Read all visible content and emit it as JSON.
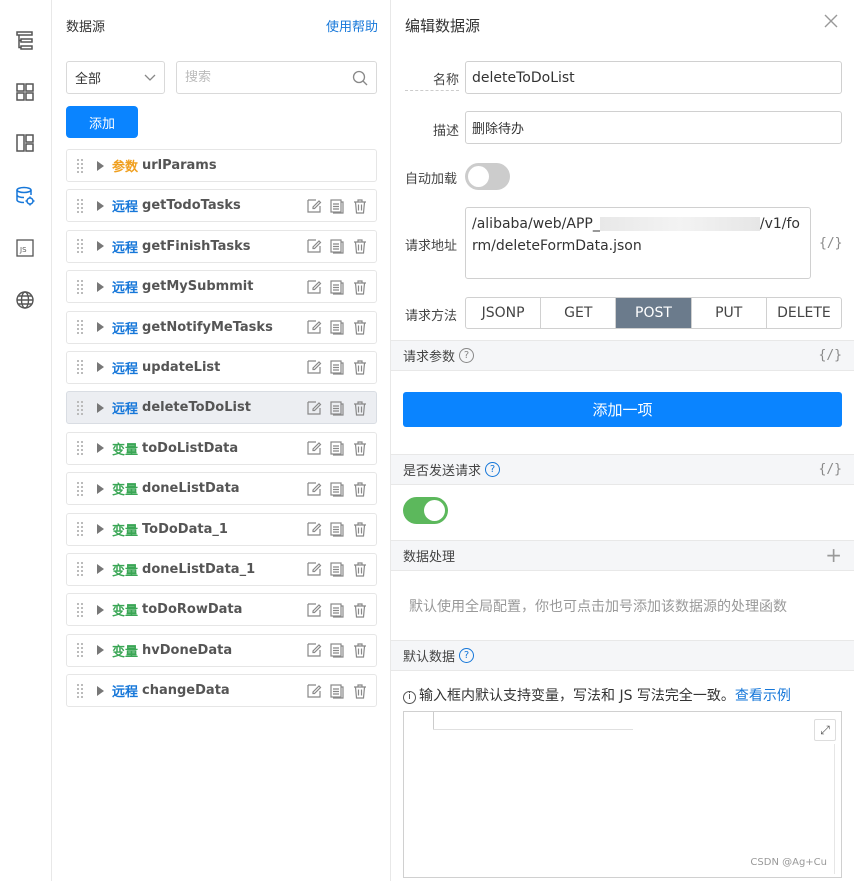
{
  "rail": {
    "icons": [
      "outline-icon",
      "components-icon",
      "layout-icon",
      "datasource-icon",
      "js-icon",
      "globe-icon"
    ]
  },
  "datasource": {
    "title": "数据源",
    "help": "使用帮助",
    "filter_value": "全部",
    "search_placeholder": "搜索",
    "add_label": "添加",
    "items": [
      {
        "tag": "参数",
        "kind": "param",
        "name": "urlParams",
        "actions": false,
        "selected": false
      },
      {
        "tag": "远程",
        "kind": "remote",
        "name": "getTodoTasks",
        "actions": true,
        "selected": false
      },
      {
        "tag": "远程",
        "kind": "remote",
        "name": "getFinishTasks",
        "actions": true,
        "selected": false
      },
      {
        "tag": "远程",
        "kind": "remote",
        "name": "getMySubmmit",
        "actions": true,
        "selected": false
      },
      {
        "tag": "远程",
        "kind": "remote",
        "name": "getNotifyMeTasks",
        "actions": true,
        "selected": false
      },
      {
        "tag": "远程",
        "kind": "remote",
        "name": "updateList",
        "actions": true,
        "selected": false
      },
      {
        "tag": "远程",
        "kind": "remote",
        "name": "deleteToDoList",
        "actions": true,
        "selected": true
      },
      {
        "tag": "变量",
        "kind": "var",
        "name": "toDoListData",
        "actions": true,
        "selected": false
      },
      {
        "tag": "变量",
        "kind": "var",
        "name": "doneListData",
        "actions": true,
        "selected": false
      },
      {
        "tag": "变量",
        "kind": "var",
        "name": "ToDoData_1",
        "actions": true,
        "selected": false
      },
      {
        "tag": "变量",
        "kind": "var",
        "name": "doneListData_1",
        "actions": true,
        "selected": false
      },
      {
        "tag": "变量",
        "kind": "var",
        "name": "toDoRowData",
        "actions": true,
        "selected": false
      },
      {
        "tag": "变量",
        "kind": "var",
        "name": "hvDoneData",
        "actions": true,
        "selected": false
      },
      {
        "tag": "远程",
        "kind": "remote",
        "name": "changeData",
        "actions": true,
        "selected": false
      }
    ]
  },
  "editor": {
    "title": "编辑数据源",
    "name_label": "名称",
    "name_value": "deleteToDoList",
    "desc_label": "描述",
    "desc_value": "删除待办",
    "autoload_label": "自动加载",
    "url_label": "请求地址",
    "url_part1": "/alibaba/web/APP_",
    "url_part2": "/v1/form/deleteFormData.json",
    "code_icon": "{/}",
    "method_label": "请求方法",
    "methods": [
      "JSONP",
      "GET",
      "POST",
      "PUT",
      "DELETE"
    ],
    "method_selected": "POST",
    "params_section": "请求参数",
    "add_item_label": "添加一项",
    "send_section": "是否发送请求",
    "processing_section": "数据处理",
    "processing_hint": "默认使用全局配置，你也可点击加号添加该数据源的处理函数",
    "default_section": "默认数据",
    "default_note": "输入框内默认支持变量，写法和 JS 写法完全一致。",
    "default_link": "查看示例",
    "watermark": "CSDN @Ag+Cu"
  }
}
